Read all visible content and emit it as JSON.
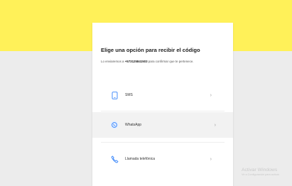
{
  "colors": {
    "brand_yellow": "#fff159",
    "icon_blue": "#3483fa"
  },
  "dialog": {
    "title": "Elige una opción para recibir el código",
    "subtitle_prefix": "Lo enviaremos a ",
    "phone": "+573125841503",
    "subtitle_suffix": " para confirmar que te pertenece.",
    "options": [
      {
        "label": "SMS",
        "icon": "phone-icon"
      },
      {
        "label": "WhatsApp",
        "icon": "whatsapp-icon"
      },
      {
        "label": "Llamada telefónica",
        "icon": "call-icon"
      }
    ],
    "chevron": "›"
  },
  "watermark": {
    "title": "Activar Windows",
    "subtitle": "Ve a Configuración para activar"
  }
}
